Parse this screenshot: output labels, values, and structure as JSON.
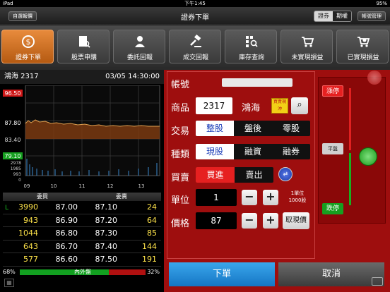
{
  "status": {
    "device": "iPad",
    "time": "下午1:45",
    "battery": "95%"
  },
  "header": {
    "left_button": "自選報價",
    "title": "證券下單",
    "segment": [
      "證券",
      "期權"
    ],
    "right_button": "帳號管理"
  },
  "menu": [
    {
      "label": "證券下單",
      "icon": "dollar-coin-icon"
    },
    {
      "label": "股票申購",
      "icon": "document-search-icon"
    },
    {
      "label": "委託回報",
      "icon": "person-icon"
    },
    {
      "label": "成交回報",
      "icon": "gavel-icon"
    },
    {
      "label": "庫存查詢",
      "icon": "grid-search-icon"
    },
    {
      "label": "未實現損益",
      "icon": "shopping-cart-icon"
    },
    {
      "label": "已實現損益",
      "icon": "cart-money-icon"
    }
  ],
  "quote": {
    "name": "鴻海 2317",
    "datetime": "03/05 14:30:00",
    "price_axis": [
      "96.50",
      "87.80",
      "83.40",
      "79.10"
    ],
    "volume_axis": [
      "2978",
      "1985",
      "993",
      "0"
    ],
    "time_axis": [
      "09",
      "10",
      "11",
      "12",
      "13"
    ]
  },
  "book": {
    "headers": [
      "委買",
      "委賣"
    ],
    "marker": "L",
    "rows": [
      [
        "3990",
        "87.00",
        "87.10",
        "24"
      ],
      [
        "943",
        "86.90",
        "87.20",
        "64"
      ],
      [
        "1044",
        "86.80",
        "87.30",
        "85"
      ],
      [
        "643",
        "86.70",
        "87.40",
        "144"
      ],
      [
        "577",
        "86.60",
        "87.50",
        "191"
      ]
    ],
    "buy_ratio": "68%",
    "sell_ratio": "32%",
    "ratio_label": "內外盤",
    "buy_fraction": 0.68
  },
  "order": {
    "account_label": "帳號",
    "product_label": "商品",
    "product_code": "2317",
    "product_name": "鴻海",
    "badge": "買賣現沖",
    "trade_label": "交易",
    "trade_options": [
      "整股",
      "盤後",
      "零股"
    ],
    "type_label": "種類",
    "type_options": [
      "現股",
      "融資",
      "融券"
    ],
    "side_label": "買賣",
    "side_options": [
      "買進",
      "賣出"
    ],
    "unit_label": "單位",
    "unit_value": "1",
    "unit_note": "1單位\n1000股",
    "price_label": "價格",
    "price_value": "87",
    "take_price": "取現價",
    "submit": "下單",
    "cancel": "取消"
  },
  "limits": {
    "up": "漲停",
    "flat": "平盤",
    "down": "跌停"
  },
  "colors": {
    "accent_orange": "#d9741e",
    "panel_red": "#9e0e0e",
    "submit_blue": "#1f8ad6"
  }
}
